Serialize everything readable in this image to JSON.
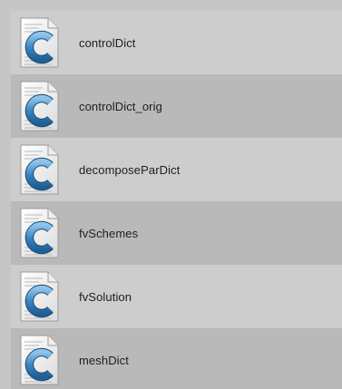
{
  "file_list": {
    "items": [
      {
        "name": "controlDict",
        "icon": "c-source-file-icon"
      },
      {
        "name": "controlDict_orig",
        "icon": "c-source-file-icon"
      },
      {
        "name": "decomposeParDict",
        "icon": "c-source-file-icon"
      },
      {
        "name": "fvSchemes",
        "icon": "c-source-file-icon"
      },
      {
        "name": "fvSolution",
        "icon": "c-source-file-icon"
      },
      {
        "name": "meshDict",
        "icon": "c-source-file-icon"
      }
    ]
  },
  "colors": {
    "row_light": "#cdcdcd",
    "row_dark": "#b9b9b9",
    "c_letter": "#2f6fa3",
    "text": "#1e1e1e"
  }
}
